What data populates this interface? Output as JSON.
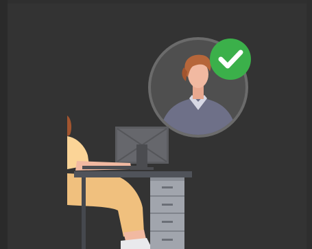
{
  "illustration": {
    "description_label": "",
    "colors": {
      "background": "#333333",
      "avatar_ring": "#6d6d6d",
      "avatar_bg": "#4e4e4e",
      "hair": "#b5663a",
      "skin": "#f1b9a1",
      "shirt": "#6d6f86",
      "check_badge": "#3bb04a",
      "monitor": "#5a5a5a",
      "desk_top": "#4f5258",
      "drawers": "#9ea2a9",
      "pants": "#f0c07e",
      "sleeve": "#fbd497"
    },
    "icons": [
      "user-avatar-icon",
      "check-badge-icon",
      "monitor-icon",
      "desk-icon",
      "person-at-desk-icon"
    ]
  }
}
